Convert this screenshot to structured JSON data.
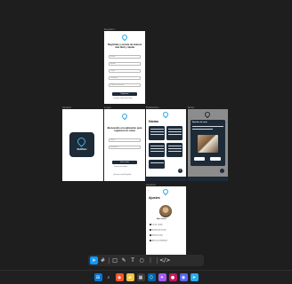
{
  "frames": {
    "registro": {
      "label": "Registro",
      "heading": "Regístrate y accede de manera más fácil y rápida",
      "fields": [
        "Nombre",
        "Apellido",
        "Correo",
        "Contraseña",
        "Confirmar contraseña"
      ],
      "button": "Registrarse",
      "footer": "¿Ya tienes cuenta? Inicia sesión"
    },
    "splash": {
      "label": "Splash",
      "app_name": "MultiNote"
    },
    "login": {
      "label": "Login",
      "heading": "Bienvenido a la aplicación para organizar tus notas",
      "fields": [
        "Correo",
        "Contraseña"
      ],
      "button": "Iniciar sesión",
      "google": "Continuar con Google",
      "footer": "¿No tienes cuenta? Regístrate"
    },
    "notas": {
      "label": "MultiNote",
      "title": "Notas",
      "fab": "+"
    },
    "nota": {
      "label": "Nota",
      "title": "Nombre de nota"
    },
    "ajustes": {
      "label": "Ajustes",
      "title": "Ajustes",
      "user": "Martín Lorenzo",
      "options": [
        "Cerrar sesión",
        "Tamaño de fuente",
        "Notificaciones",
        "Acerca de Multinote"
      ]
    }
  },
  "toolbar": {
    "tools": [
      "move-tool",
      "frame-tool",
      "shape-tool",
      "pen-tool",
      "text-tool",
      "comment-tool",
      "actions-tool",
      "dev-mode"
    ],
    "active": "move-tool"
  },
  "taskbar": {
    "apps": [
      "windows-start",
      "search",
      "brave-browser",
      "files",
      "store",
      "vs-code",
      "figma",
      "app",
      "app2",
      "telegram"
    ]
  },
  "colors": {
    "canvas": "#1e1e1e",
    "frame_dark": "#1d2a38",
    "accent": "#0d99ff",
    "brand_blue": "#2aa7e0"
  }
}
